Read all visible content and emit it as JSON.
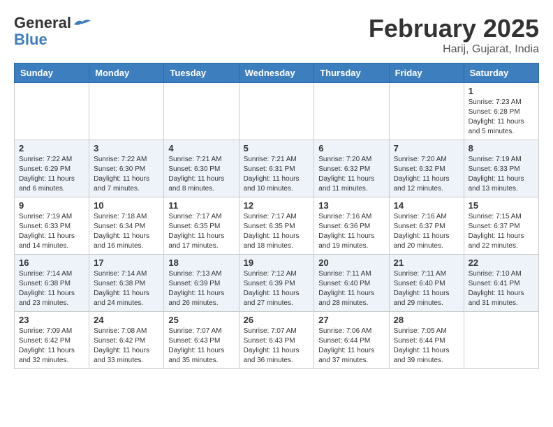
{
  "header": {
    "logo_general": "General",
    "logo_blue": "Blue",
    "month_year": "February 2025",
    "location": "Harij, Gujarat, India"
  },
  "days_of_week": [
    "Sunday",
    "Monday",
    "Tuesday",
    "Wednesday",
    "Thursday",
    "Friday",
    "Saturday"
  ],
  "weeks": [
    {
      "cells": [
        {
          "empty": true
        },
        {
          "empty": true
        },
        {
          "empty": true
        },
        {
          "empty": true
        },
        {
          "empty": true
        },
        {
          "empty": true
        },
        {
          "day": 1,
          "sunrise": "7:23 AM",
          "sunset": "6:28 PM",
          "daylight": "11 hours and 5 minutes."
        }
      ]
    },
    {
      "cells": [
        {
          "day": 2,
          "sunrise": "7:22 AM",
          "sunset": "6:29 PM",
          "daylight": "11 hours and 6 minutes."
        },
        {
          "day": 3,
          "sunrise": "7:22 AM",
          "sunset": "6:30 PM",
          "daylight": "11 hours and 7 minutes."
        },
        {
          "day": 4,
          "sunrise": "7:21 AM",
          "sunset": "6:30 PM",
          "daylight": "11 hours and 8 minutes."
        },
        {
          "day": 5,
          "sunrise": "7:21 AM",
          "sunset": "6:31 PM",
          "daylight": "11 hours and 10 minutes."
        },
        {
          "day": 6,
          "sunrise": "7:20 AM",
          "sunset": "6:32 PM",
          "daylight": "11 hours and 11 minutes."
        },
        {
          "day": 7,
          "sunrise": "7:20 AM",
          "sunset": "6:32 PM",
          "daylight": "11 hours and 12 minutes."
        },
        {
          "day": 8,
          "sunrise": "7:19 AM",
          "sunset": "6:33 PM",
          "daylight": "11 hours and 13 minutes."
        }
      ]
    },
    {
      "cells": [
        {
          "day": 9,
          "sunrise": "7:19 AM",
          "sunset": "6:33 PM",
          "daylight": "11 hours and 14 minutes."
        },
        {
          "day": 10,
          "sunrise": "7:18 AM",
          "sunset": "6:34 PM",
          "daylight": "11 hours and 16 minutes."
        },
        {
          "day": 11,
          "sunrise": "7:17 AM",
          "sunset": "6:35 PM",
          "daylight": "11 hours and 17 minutes."
        },
        {
          "day": 12,
          "sunrise": "7:17 AM",
          "sunset": "6:35 PM",
          "daylight": "11 hours and 18 minutes."
        },
        {
          "day": 13,
          "sunrise": "7:16 AM",
          "sunset": "6:36 PM",
          "daylight": "11 hours and 19 minutes."
        },
        {
          "day": 14,
          "sunrise": "7:16 AM",
          "sunset": "6:37 PM",
          "daylight": "11 hours and 20 minutes."
        },
        {
          "day": 15,
          "sunrise": "7:15 AM",
          "sunset": "6:37 PM",
          "daylight": "11 hours and 22 minutes."
        }
      ]
    },
    {
      "cells": [
        {
          "day": 16,
          "sunrise": "7:14 AM",
          "sunset": "6:38 PM",
          "daylight": "11 hours and 23 minutes."
        },
        {
          "day": 17,
          "sunrise": "7:14 AM",
          "sunset": "6:38 PM",
          "daylight": "11 hours and 24 minutes."
        },
        {
          "day": 18,
          "sunrise": "7:13 AM",
          "sunset": "6:39 PM",
          "daylight": "11 hours and 26 minutes."
        },
        {
          "day": 19,
          "sunrise": "7:12 AM",
          "sunset": "6:39 PM",
          "daylight": "11 hours and 27 minutes."
        },
        {
          "day": 20,
          "sunrise": "7:11 AM",
          "sunset": "6:40 PM",
          "daylight": "11 hours and 28 minutes."
        },
        {
          "day": 21,
          "sunrise": "7:11 AM",
          "sunset": "6:40 PM",
          "daylight": "11 hours and 29 minutes."
        },
        {
          "day": 22,
          "sunrise": "7:10 AM",
          "sunset": "6:41 PM",
          "daylight": "11 hours and 31 minutes."
        }
      ]
    },
    {
      "cells": [
        {
          "day": 23,
          "sunrise": "7:09 AM",
          "sunset": "6:42 PM",
          "daylight": "11 hours and 32 minutes."
        },
        {
          "day": 24,
          "sunrise": "7:08 AM",
          "sunset": "6:42 PM",
          "daylight": "11 hours and 33 minutes."
        },
        {
          "day": 25,
          "sunrise": "7:07 AM",
          "sunset": "6:43 PM",
          "daylight": "11 hours and 35 minutes."
        },
        {
          "day": 26,
          "sunrise": "7:07 AM",
          "sunset": "6:43 PM",
          "daylight": "11 hours and 36 minutes."
        },
        {
          "day": 27,
          "sunrise": "7:06 AM",
          "sunset": "6:44 PM",
          "daylight": "11 hours and 37 minutes."
        },
        {
          "day": 28,
          "sunrise": "7:05 AM",
          "sunset": "6:44 PM",
          "daylight": "11 hours and 39 minutes."
        },
        {
          "empty": true
        }
      ]
    }
  ]
}
